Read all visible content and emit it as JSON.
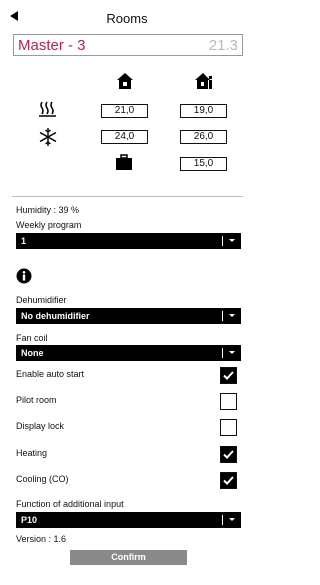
{
  "header": {
    "title": "Rooms"
  },
  "room": {
    "name": "Master - 3",
    "temperature": "21.3"
  },
  "setpoints": {
    "comfort": {
      "home": "21,0",
      "away": "19,0"
    },
    "cooling": {
      "home": "24,0",
      "away": "26,0"
    },
    "holiday": {
      "away": "15,0"
    }
  },
  "humidity_label": "Humidity : 39 %",
  "weekly_program": {
    "label": "Weekly program",
    "value": "1"
  },
  "dehumidifier": {
    "label": "Dehumidifier",
    "value": "No dehumidifier"
  },
  "fan_coil": {
    "label": "Fan coil",
    "value": "None"
  },
  "options": [
    {
      "label": "Enable auto start",
      "checked": true
    },
    {
      "label": "Pilot room",
      "checked": false
    },
    {
      "label": "Display lock",
      "checked": false
    },
    {
      "label": "Heating",
      "checked": true
    },
    {
      "label": "Cooling (CO)",
      "checked": true
    }
  ],
  "additional_input": {
    "label": "Function of additional input",
    "value": "P10"
  },
  "version_label": "Version : 1.6",
  "confirm_label": "Confirm",
  "icons": {
    "back": "back-arrow-icon",
    "home": "home-icon",
    "home_away": "home-away-icon",
    "heating": "heating-waves-icon",
    "cooling": "snowflake-icon",
    "holiday": "suitcase-icon",
    "info": "info-icon"
  },
  "colors": {
    "room_name": "#b0245a",
    "room_temp": "#bbbbbb",
    "confirm_bg": "#8a8a8a"
  }
}
